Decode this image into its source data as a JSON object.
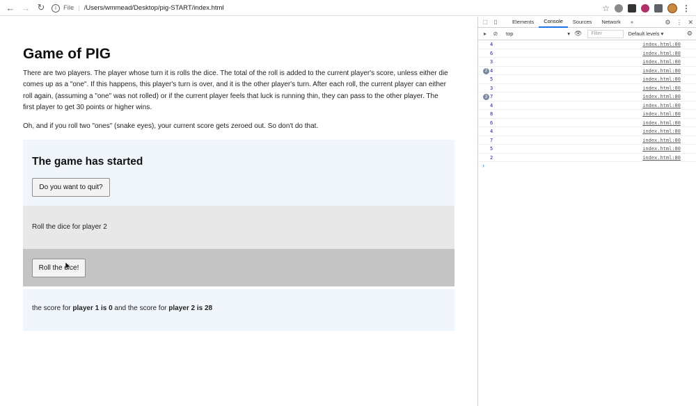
{
  "browser": {
    "back_icon": "←",
    "forward_icon": "→",
    "reload_icon": "↻",
    "address_prefix": "File",
    "address_separator": "|",
    "url": "/Users/wmmead/Desktop/pig-START/index.html",
    "info_icon": "i",
    "star_icon": "☆",
    "menu_icon": "⋮"
  },
  "page": {
    "title": "Game of PIG",
    "paragraph_1": "There are two players. The player whose turn it is rolls the dice. The total of the roll is added to the current player's score, unless either die comes up as a \"one\". If this happens, this player's turn is over, and it is the other player's turn. After each roll, the current player can either roll again, (assuming a \"one\" was not rolled) or if the current player feels that luck is running thin, they can pass to the other player. The first player to get 30 points or higher wins.",
    "paragraph_2": "Oh, and if you roll two \"ones\" (snake eyes), your current score gets zeroed out. So don't do that.",
    "status_heading": "The game has started",
    "quit_button": "Do you want to quit?",
    "turn_text": "Roll the dice for player 2",
    "roll_button": "Roll the dice!",
    "score": {
      "prefix": "the score for",
      "player1_bold": "player 1 is 0",
      "middle": "and the score for",
      "player2_bold": "player 2 is 28"
    }
  },
  "devtools": {
    "tabs": [
      "Elements",
      "Console",
      "Sources",
      "Network"
    ],
    "more_icon": "»",
    "context": "top",
    "context_arrow": "▾",
    "filter_placeholder": "Filter",
    "levels": "Default levels ▾",
    "settings_icon": "⚙",
    "overflow_icon": "⋮",
    "close_icon": "✕",
    "prompt_caret": "›",
    "logs": [
      {
        "value": "4",
        "badge": "",
        "source": "index.html:80"
      },
      {
        "value": "6",
        "badge": "",
        "source": "index.html:80"
      },
      {
        "value": "3",
        "badge": "",
        "source": "index.html:80"
      },
      {
        "value": "4",
        "badge": "2",
        "source": "index.html:80"
      },
      {
        "value": "5",
        "badge": "",
        "source": "index.html:80"
      },
      {
        "value": "3",
        "badge": "",
        "source": "index.html:80"
      },
      {
        "value": "7",
        "badge": "3",
        "source": "index.html:80"
      },
      {
        "value": "4",
        "badge": "",
        "source": "index.html:80"
      },
      {
        "value": "8",
        "badge": "",
        "source": "index.html:80"
      },
      {
        "value": "6",
        "badge": "",
        "source": "index.html:80"
      },
      {
        "value": "4",
        "badge": "",
        "source": "index.html:80"
      },
      {
        "value": "7",
        "badge": "",
        "source": "index.html:80"
      },
      {
        "value": "5",
        "badge": "",
        "source": "index.html:80"
      },
      {
        "value": "2",
        "badge": "",
        "source": "index.html:80"
      }
    ]
  },
  "colors": {
    "header_bg": "#f0f6fc",
    "turn_bg": "#e8e8e8",
    "roll_bg": "#c4c4c4",
    "log_value": "#1a1aa6",
    "devtools_accent": "#1a73e8"
  }
}
